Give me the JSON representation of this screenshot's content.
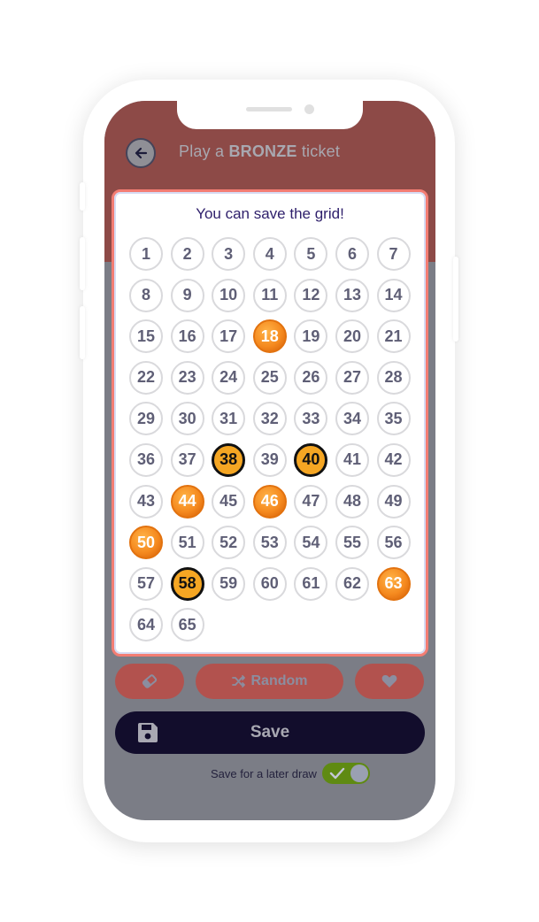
{
  "header": {
    "title_prefix": "Play a ",
    "title_bold": "BRONZE",
    "title_suffix": " ticket"
  },
  "grid": {
    "message": "You can save the grid!",
    "numbers": [
      {
        "n": "1",
        "s": "none"
      },
      {
        "n": "2",
        "s": "none"
      },
      {
        "n": "3",
        "s": "none"
      },
      {
        "n": "4",
        "s": "none"
      },
      {
        "n": "5",
        "s": "none"
      },
      {
        "n": "6",
        "s": "none"
      },
      {
        "n": "7",
        "s": "none"
      },
      {
        "n": "8",
        "s": "none"
      },
      {
        "n": "9",
        "s": "none"
      },
      {
        "n": "10",
        "s": "none"
      },
      {
        "n": "11",
        "s": "none"
      },
      {
        "n": "12",
        "s": "none"
      },
      {
        "n": "13",
        "s": "none"
      },
      {
        "n": "14",
        "s": "none"
      },
      {
        "n": "15",
        "s": "none"
      },
      {
        "n": "16",
        "s": "none"
      },
      {
        "n": "17",
        "s": "none"
      },
      {
        "n": "18",
        "s": "orange"
      },
      {
        "n": "19",
        "s": "none"
      },
      {
        "n": "20",
        "s": "none"
      },
      {
        "n": "21",
        "s": "none"
      },
      {
        "n": "22",
        "s": "none"
      },
      {
        "n": "23",
        "s": "none"
      },
      {
        "n": "24",
        "s": "none"
      },
      {
        "n": "25",
        "s": "none"
      },
      {
        "n": "26",
        "s": "none"
      },
      {
        "n": "27",
        "s": "none"
      },
      {
        "n": "28",
        "s": "none"
      },
      {
        "n": "29",
        "s": "none"
      },
      {
        "n": "30",
        "s": "none"
      },
      {
        "n": "31",
        "s": "none"
      },
      {
        "n": "32",
        "s": "none"
      },
      {
        "n": "33",
        "s": "none"
      },
      {
        "n": "34",
        "s": "none"
      },
      {
        "n": "35",
        "s": "none"
      },
      {
        "n": "36",
        "s": "none"
      },
      {
        "n": "37",
        "s": "none"
      },
      {
        "n": "38",
        "s": "gold"
      },
      {
        "n": "39",
        "s": "none"
      },
      {
        "n": "40",
        "s": "gold"
      },
      {
        "n": "41",
        "s": "none"
      },
      {
        "n": "42",
        "s": "none"
      },
      {
        "n": "43",
        "s": "none"
      },
      {
        "n": "44",
        "s": "orange"
      },
      {
        "n": "45",
        "s": "none"
      },
      {
        "n": "46",
        "s": "orange"
      },
      {
        "n": "47",
        "s": "none"
      },
      {
        "n": "48",
        "s": "none"
      },
      {
        "n": "49",
        "s": "none"
      },
      {
        "n": "50",
        "s": "orange"
      },
      {
        "n": "51",
        "s": "none"
      },
      {
        "n": "52",
        "s": "none"
      },
      {
        "n": "53",
        "s": "none"
      },
      {
        "n": "54",
        "s": "none"
      },
      {
        "n": "55",
        "s": "none"
      },
      {
        "n": "56",
        "s": "none"
      },
      {
        "n": "57",
        "s": "none"
      },
      {
        "n": "58",
        "s": "gold"
      },
      {
        "n": "59",
        "s": "none"
      },
      {
        "n": "60",
        "s": "none"
      },
      {
        "n": "61",
        "s": "none"
      },
      {
        "n": "62",
        "s": "none"
      },
      {
        "n": "63",
        "s": "orange"
      },
      {
        "n": "64",
        "s": "none"
      },
      {
        "n": "65",
        "s": "none"
      }
    ]
  },
  "actions": {
    "eraser_icon": "eraser-icon",
    "random_label": "Random",
    "random_icon": "shuffle-icon",
    "favorite_icon": "heart-icon"
  },
  "save": {
    "label": "Save",
    "icon": "floppy-disk-icon"
  },
  "later": {
    "label": "Save for a later draw",
    "enabled": true
  },
  "colors": {
    "header_bg": "#8d4a47",
    "overlay": "#7b7d86",
    "card_border": "#f37d73",
    "ball_orange": "#f58a1f",
    "ball_gold": "#f5a623",
    "button_bg": "#b2524e",
    "save_bg": "#120d2c",
    "toggle_on": "#5f8a12",
    "message_text": "#2e1f6b"
  }
}
